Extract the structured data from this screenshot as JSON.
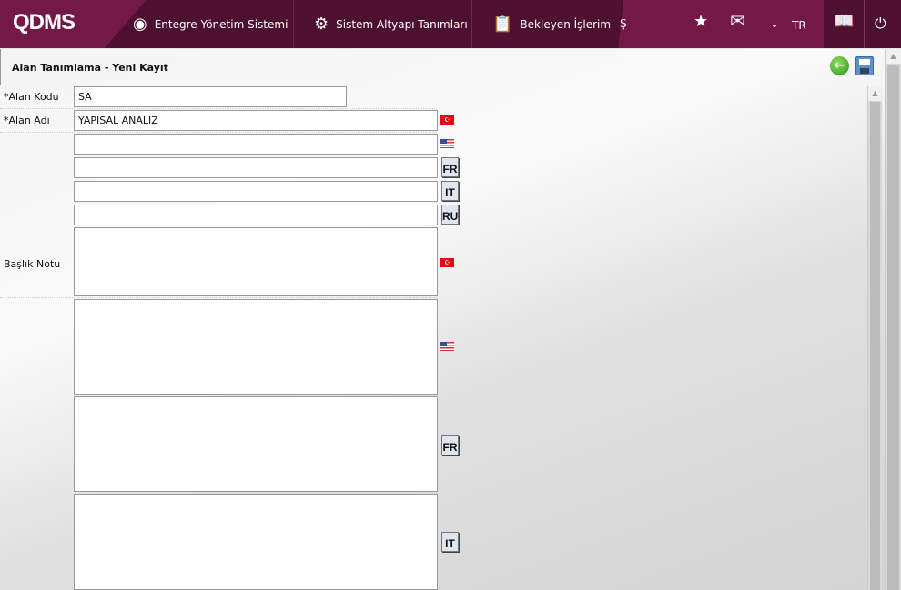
{
  "header": {
    "logo": "QDMS",
    "nav": [
      {
        "label": "Entegre Yönetim Sistemi",
        "icon": "q-icon"
      },
      {
        "label": "Sistem Altyapı Tanımları",
        "icon": "gear-icon"
      },
      {
        "label": "Bekleyen İşlerim",
        "icon": "clipboard-icon"
      }
    ],
    "overflow": "Ş",
    "language": "TR"
  },
  "panel": {
    "title": "Alan Tanımlama - Yeni Kayıt"
  },
  "form": {
    "code_label": "*Alan Kodu",
    "code_value": "SA",
    "name_label": "*Alan Adı",
    "name_tr": "YAPISAL ANALİZ",
    "name_en": "",
    "name_fr": "",
    "name_it": "",
    "name_ru": "",
    "note_label": "Başlık Notu",
    "langs": {
      "tr": "TR",
      "fr": "FR",
      "it": "IT",
      "ru": "RU"
    }
  },
  "colors": {
    "header": "#741848",
    "header_dark": "#4e1030"
  }
}
